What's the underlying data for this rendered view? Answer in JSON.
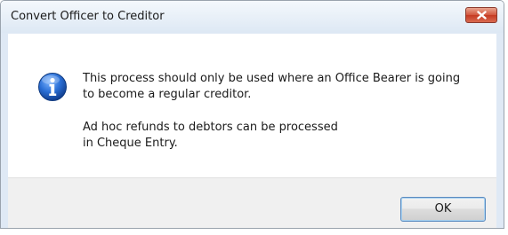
{
  "dialog": {
    "title": "Convert Officer to Creditor",
    "message": {
      "paragraph1_line1": "This process should only be used where an Office Bearer is going",
      "paragraph1_line2": "to become a regular creditor.",
      "paragraph2_line1": "Ad hoc refunds to debtors can be processed",
      "paragraph2_line2": "in Cheque Entry."
    },
    "ok_label": "OK",
    "icon": "info-icon",
    "close_icon": "close-icon"
  },
  "colors": {
    "close_button": "#d2553d",
    "info_icon": "#1e63c3",
    "ok_border": "#5b8bbf"
  }
}
